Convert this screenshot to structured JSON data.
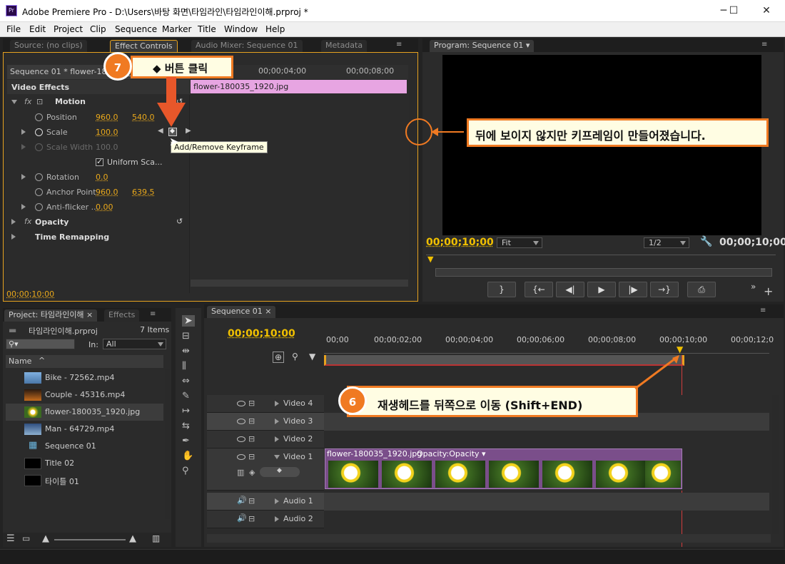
{
  "window": {
    "app_icon": "Pr",
    "title": "Adobe Premiere Pro - D:\\Users\\바탕 화면\\타임라인\\타임라인이해.prproj *",
    "minimize": "─",
    "maximize": "☐",
    "close": "✕"
  },
  "menu": [
    "File",
    "Edit",
    "Project",
    "Clip",
    "Sequence",
    "Marker",
    "Title",
    "Window",
    "Help"
  ],
  "source_panel": {
    "tabs": [
      "Source: (no clips)",
      "Effect Controls",
      "Audio Mixer: Sequence 01",
      "Metadata"
    ],
    "sequence_label": "Sequence 01 * flower-180035_1920.jpg",
    "ruler_times": [
      "00;00;04;00",
      "00;00;08;00"
    ],
    "clip_name": "flower-180035_1920.jpg",
    "section_title": "Video Effects",
    "effects": [
      {
        "name": "Motion",
        "values": []
      },
      {
        "name": "Position",
        "values": [
          "960.0",
          "540.0"
        ]
      },
      {
        "name": "Scale",
        "values": [
          "100.0"
        ]
      },
      {
        "name": "Scale Width",
        "values": [
          "100.0"
        ]
      },
      {
        "name": "Uniform Sca...",
        "values": []
      },
      {
        "name": "Rotation",
        "values": [
          "0.0"
        ]
      },
      {
        "name": "Anchor Point",
        "values": [
          "960.0",
          "639.5"
        ]
      },
      {
        "name": "Anti-flicker ...",
        "values": [
          "0.00"
        ]
      },
      {
        "name": "Opacity",
        "values": []
      },
      {
        "name": "Time Remapping",
        "values": []
      }
    ],
    "tooltip": "Add/Remove Keyframe",
    "current_time": "00;00;10;00"
  },
  "program_panel": {
    "tab": "Program: Sequence 01",
    "timecode_left": "00;00;10;00",
    "fit": "Fit",
    "resolution": "1/2",
    "timecode_right": "00;00;10;00"
  },
  "project_panel": {
    "tabs": [
      "Project: 타임라인이해",
      "Effects"
    ],
    "project_file": "타임라인이해.prproj",
    "item_count": "7 Items",
    "in_label": "In:",
    "in_value": "All",
    "column_name": "Name",
    "items": [
      "Bike - 72562.mp4",
      "Couple - 45316.mp4",
      "flower-180035_1920.jpg",
      "Man - 64729.mp4",
      "Sequence 01",
      "Title 02",
      "타이틀 01"
    ]
  },
  "timeline": {
    "tab": "Sequence 01",
    "current_time": "00;00;10:00",
    "ruler": [
      "00;00",
      "00;00;02;00",
      "00;00;04;00",
      "00;00;06;00",
      "00;00;08;00",
      "00;00;10;00",
      "00;00;12;0"
    ],
    "video_tracks": [
      "Video 4",
      "Video 3",
      "Video 2",
      "Video 1"
    ],
    "audio_tracks": [
      "Audio 1",
      "Audio 2"
    ],
    "clip_label": "flower-180035_1920.jpg",
    "clip_effect": "Opacity:Opacity ▾"
  },
  "callouts": {
    "step7_num": "7",
    "step7_text": "◆ 버튼 클릭",
    "step6_num": "6",
    "step6_text": "재생헤드를 뒤쪽으로 이동 (Shift+END)",
    "note_text": "뒤에 보이지 않지만 키프레임이 만들어졌습니다."
  },
  "colors": {
    "accent": "#e9a81b",
    "callout": "#f07a22",
    "clip_pink": "#e7a5e2",
    "clip_purple": "#7a4e8a"
  }
}
